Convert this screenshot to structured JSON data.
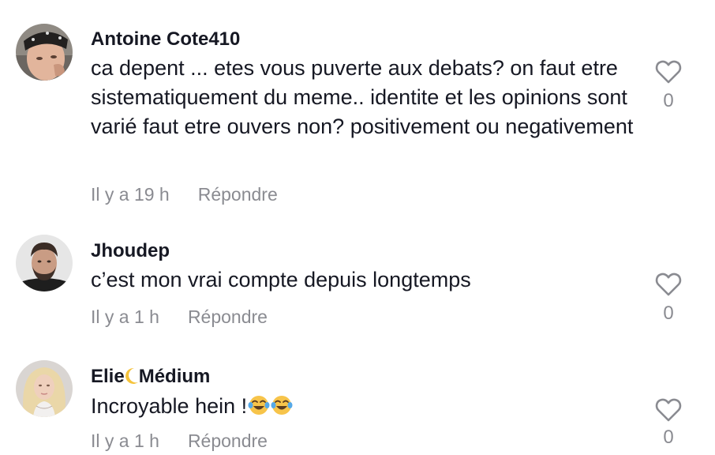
{
  "comments": [
    {
      "username": "Antoine Cote410",
      "text": "ca depent ... etes vous puverte aux debats? on faut etre sistematiquement du meme.. identite et les opinions sont varié faut etre ouvers non? positivement ou negativement",
      "time": "Il y a 19 h",
      "reply_label": "Répondre",
      "likes": "0",
      "avatar": "man-bandana-avatar"
    },
    {
      "username": "Jhoudep",
      "text": "c’est mon vrai compte depuis longtemps",
      "time": "Il y a 1 h",
      "reply_label": "Répondre",
      "likes": "0",
      "avatar": "man-beard-avatar"
    },
    {
      "username_part1": "Elie",
      "username_part2": "Médium",
      "username_icon": "crescent-moon-emoji",
      "text": "Incroyable hein !",
      "text_emojis": [
        "face-with-tears-of-joy",
        "face-with-tears-of-joy"
      ],
      "time": "Il y a 1 h",
      "reply_label": "Répondre",
      "likes": "0",
      "avatar": "woman-blonde-avatar"
    }
  ],
  "colors": {
    "text_primary": "#161823",
    "text_secondary": "#8a8b91",
    "heart_outline": "#8a8b91",
    "moon": "#f5c33b",
    "emoji": "#f7c44a"
  }
}
